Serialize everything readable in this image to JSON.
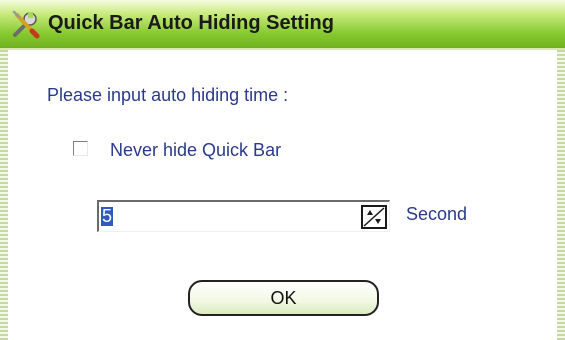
{
  "window": {
    "title": "Quick Bar Auto Hiding Setting",
    "icon": "tools-icon"
  },
  "prompt": "Please input auto hiding time :",
  "never_hide": {
    "label": "Never hide Quick Bar",
    "checked": false
  },
  "time": {
    "value": "5",
    "unit": "Second"
  },
  "buttons": {
    "ok": "OK"
  },
  "colors": {
    "titlebar": "#86c930",
    "label_text": "#2a3a8a",
    "selection": "#2f5bbf"
  }
}
